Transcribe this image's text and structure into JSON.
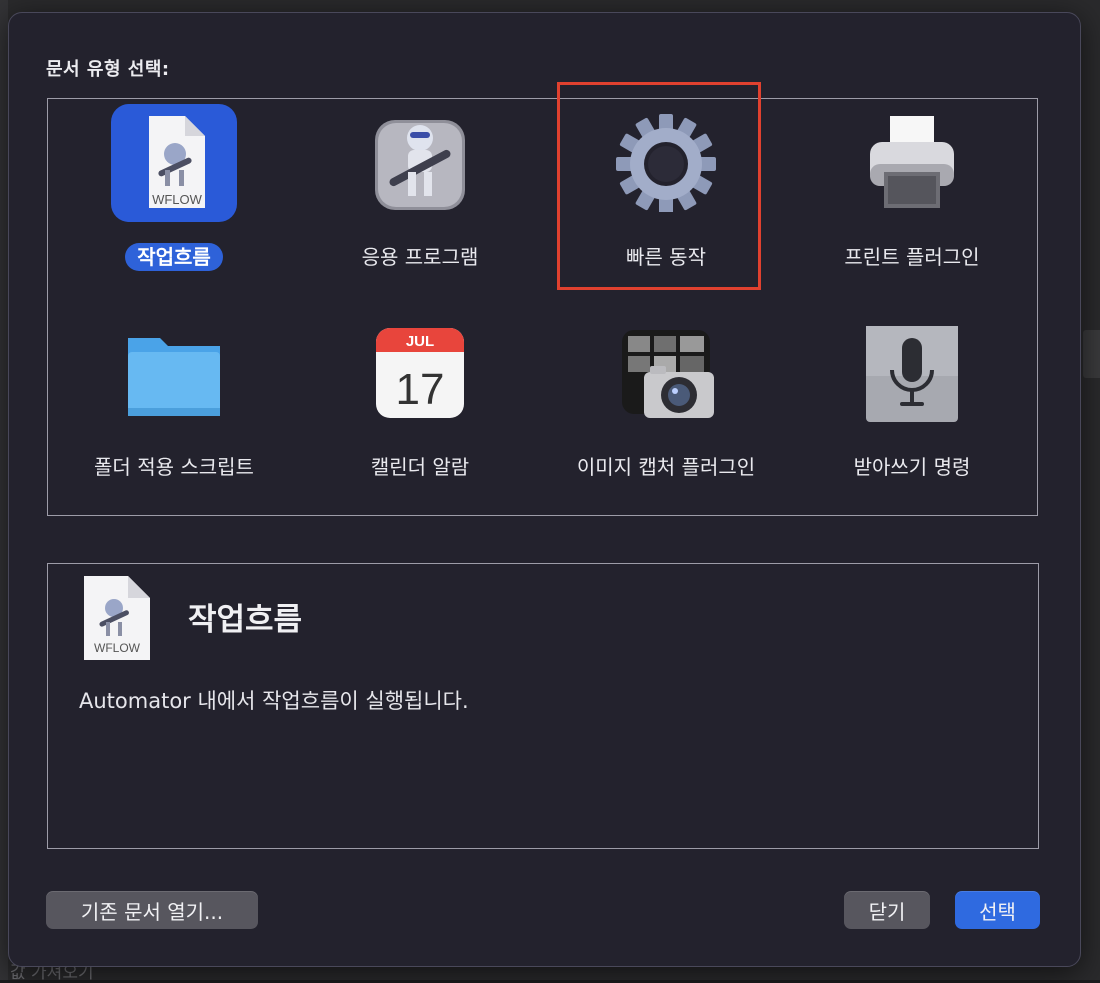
{
  "dialog": {
    "heading": "문서 유형 선택:",
    "document_types": [
      {
        "label": "작업흐름",
        "icon": "workflow-file-icon",
        "selected": true,
        "file_badge": "WFLOW"
      },
      {
        "label": "응용 프로그램",
        "icon": "automator-app-icon",
        "selected": false
      },
      {
        "label": "빠른 동작",
        "icon": "gear-icon",
        "selected": false
      },
      {
        "label": "프린트 플러그인",
        "icon": "printer-icon",
        "selected": false
      },
      {
        "label": "폴더 적용 스크립트",
        "icon": "folder-icon",
        "selected": false
      },
      {
        "label": "캘린더 알람",
        "icon": "calendar-icon",
        "selected": false,
        "calendar_month": "JUL",
        "calendar_day": "17"
      },
      {
        "label": "이미지 캡처 플러그인",
        "icon": "image-capture-icon",
        "selected": false
      },
      {
        "label": "받아쓰기 명령",
        "icon": "microphone-icon",
        "selected": false
      }
    ],
    "description": {
      "icon": "workflow-file-icon",
      "file_badge": "WFLOW",
      "title": "작업흐름",
      "text": "Automator 내에서 작업흐름이 실행됩니다."
    },
    "buttons": {
      "open_existing": "기존 문서 열기...",
      "close": "닫기",
      "choose": "선택"
    }
  },
  "colors": {
    "selection_blue": "#2e62d9",
    "highlight_red": "#e0412f",
    "sheet_bg": "#23222d"
  },
  "background": {
    "partial_text": "값 가져오기"
  }
}
